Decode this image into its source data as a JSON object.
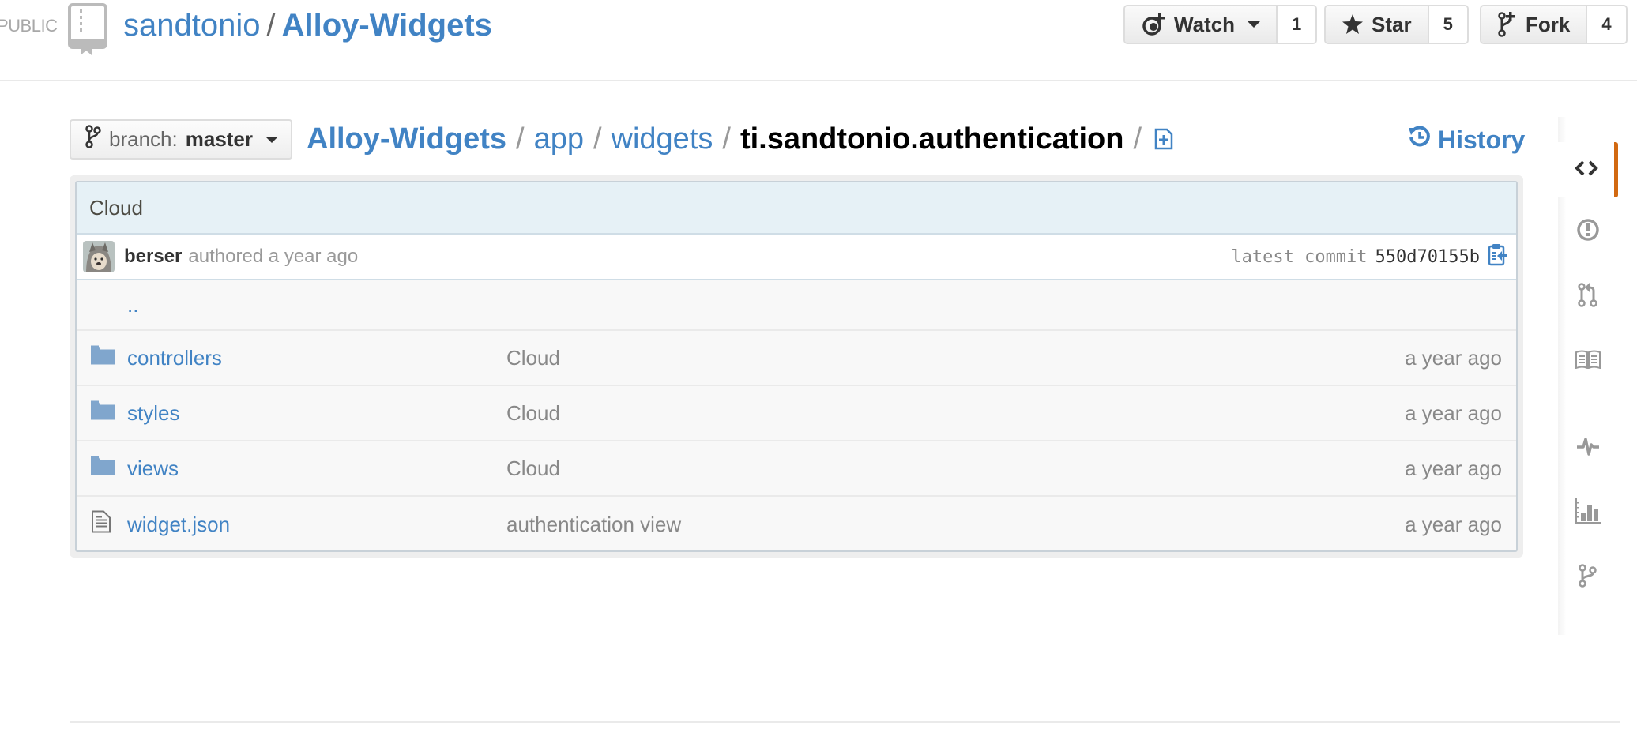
{
  "header": {
    "visibility_label": "PUBLIC",
    "owner": "sandtonio",
    "separator": "/",
    "repo_name": "Alloy-Widgets",
    "actions": [
      {
        "id": "watch",
        "label": "Watch",
        "icon": "eye-icon",
        "count": "1",
        "has_dropdown": true
      },
      {
        "id": "star",
        "label": "Star",
        "icon": "star-icon",
        "count": "5"
      },
      {
        "id": "fork",
        "label": "Fork",
        "icon": "repo-forked-icon",
        "count": "4"
      }
    ]
  },
  "branch": {
    "label": "branch:",
    "value": "master"
  },
  "breadcrumb": {
    "root": "Alloy-Widgets",
    "parts": [
      "app",
      "widgets"
    ],
    "current": "ti.sandtonio.authentication",
    "separator": "/"
  },
  "history_label": "History",
  "commit": {
    "message": "Cloud",
    "author": "berser",
    "authored_text": "authored a year ago",
    "latest_label": "latest commit",
    "sha": "550d70155b"
  },
  "files": {
    "parent_label": "..",
    "items": [
      {
        "type": "directory",
        "icon": "folder-icon",
        "name": "controllers",
        "message": "Cloud",
        "age": "a year ago"
      },
      {
        "type": "directory",
        "icon": "folder-icon",
        "name": "styles",
        "message": "Cloud",
        "age": "a year ago"
      },
      {
        "type": "directory",
        "icon": "folder-icon",
        "name": "views",
        "message": "Cloud",
        "age": "a year ago"
      },
      {
        "type": "file",
        "icon": "file-text-icon",
        "name": "widget.json",
        "message": "authentication view",
        "age": "a year ago"
      }
    ]
  },
  "repo_nav": [
    {
      "id": "code",
      "icon": "code-icon",
      "active": true
    },
    {
      "id": "issues",
      "icon": "issue-opened-icon"
    },
    {
      "id": "pull-requests",
      "icon": "git-pull-request-icon"
    },
    {
      "id": "wiki",
      "icon": "book-icon"
    },
    {
      "id": "pulse",
      "icon": "pulse-icon"
    },
    {
      "id": "graphs",
      "icon": "graph-icon"
    },
    {
      "id": "network",
      "icon": "git-branch-icon"
    }
  ],
  "colors": {
    "link": "#4183c4",
    "active_tab_accent": "#d26911",
    "commit_header_bg": "#e6f1f6",
    "folder": "#80a6cd"
  }
}
